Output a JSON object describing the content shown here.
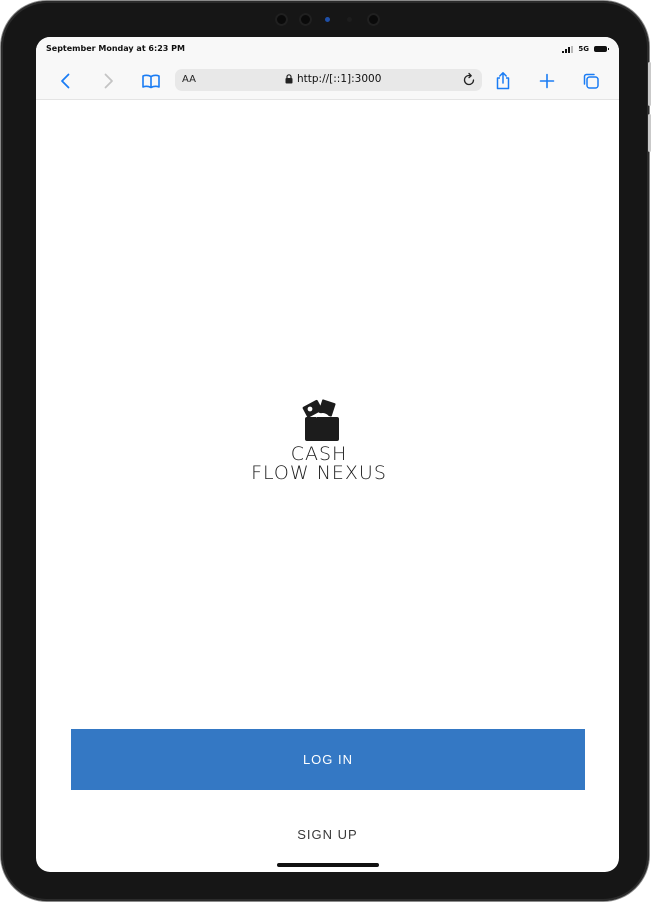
{
  "status_bar": {
    "time": "September Monday at 6:23 PM",
    "network": "5G"
  },
  "browser": {
    "text_size_label": "AA",
    "url": "http://[::1]:3000",
    "icons": [
      "back-icon",
      "forward-icon",
      "bookmarks-icon",
      "lock-icon",
      "reload-icon",
      "share-icon",
      "new-tab-icon",
      "tabs-icon"
    ]
  },
  "app": {
    "logo_line1": "CASH",
    "logo_line2": "FLOW NEXUS",
    "login_label": "LOG IN",
    "signup_label": "SIGN UP"
  },
  "colors": {
    "accent": "#3478c4",
    "browser_blue": "#1a7cf4"
  }
}
